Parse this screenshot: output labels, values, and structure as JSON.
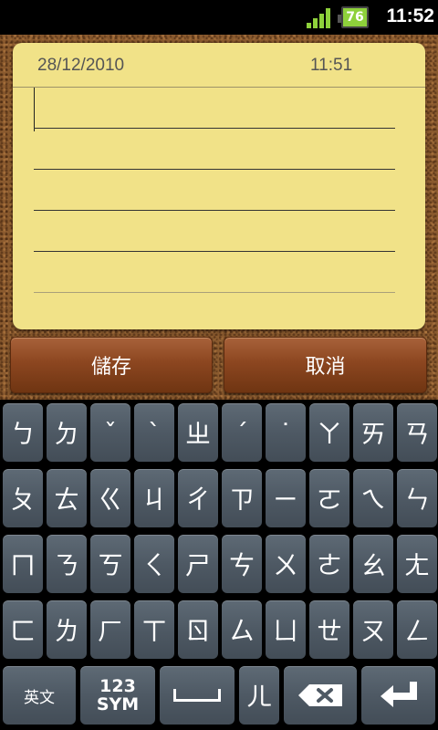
{
  "status_bar": {
    "battery_level": "76",
    "time": "11:52",
    "signal_icon": "signal-icon",
    "accent": "#8ed13b"
  },
  "note": {
    "date": "28/12/2010",
    "time": "11:51",
    "content": "",
    "background": "#f1e288"
  },
  "buttons": {
    "save_label": "儲存",
    "cancel_label": "取消"
  },
  "keyboard": {
    "rows": [
      [
        "ㄅ",
        "ㄉ",
        "ˇ",
        "ˋ",
        "ㄓ",
        "ˊ",
        "˙",
        "ㄚ",
        "ㄞ",
        "ㄢ"
      ],
      [
        "ㄆ",
        "ㄊ",
        "ㄍ",
        "ㄐ",
        "ㄔ",
        "ㄗ",
        "ㄧ",
        "ㄛ",
        "ㄟ",
        "ㄣ"
      ],
      [
        "ㄇ",
        "ㄋ",
        "ㄎ",
        "ㄑ",
        "ㄕ",
        "ㄘ",
        "ㄨ",
        "ㄜ",
        "ㄠ",
        "ㄤ"
      ],
      [
        "ㄈ",
        "ㄌ",
        "ㄏ",
        "ㄒ",
        "ㄖ",
        "ㄙ",
        "ㄩ",
        "ㄝ",
        "ㄡ",
        "ㄥ"
      ]
    ],
    "bottom": {
      "lang_label": "英文",
      "sym_label_1": "123",
      "sym_label_2": "SYM",
      "er_label": "ㄦ",
      "space_icon": "space-icon",
      "delete_icon": "backspace-icon",
      "enter_icon": "enter-icon"
    }
  }
}
